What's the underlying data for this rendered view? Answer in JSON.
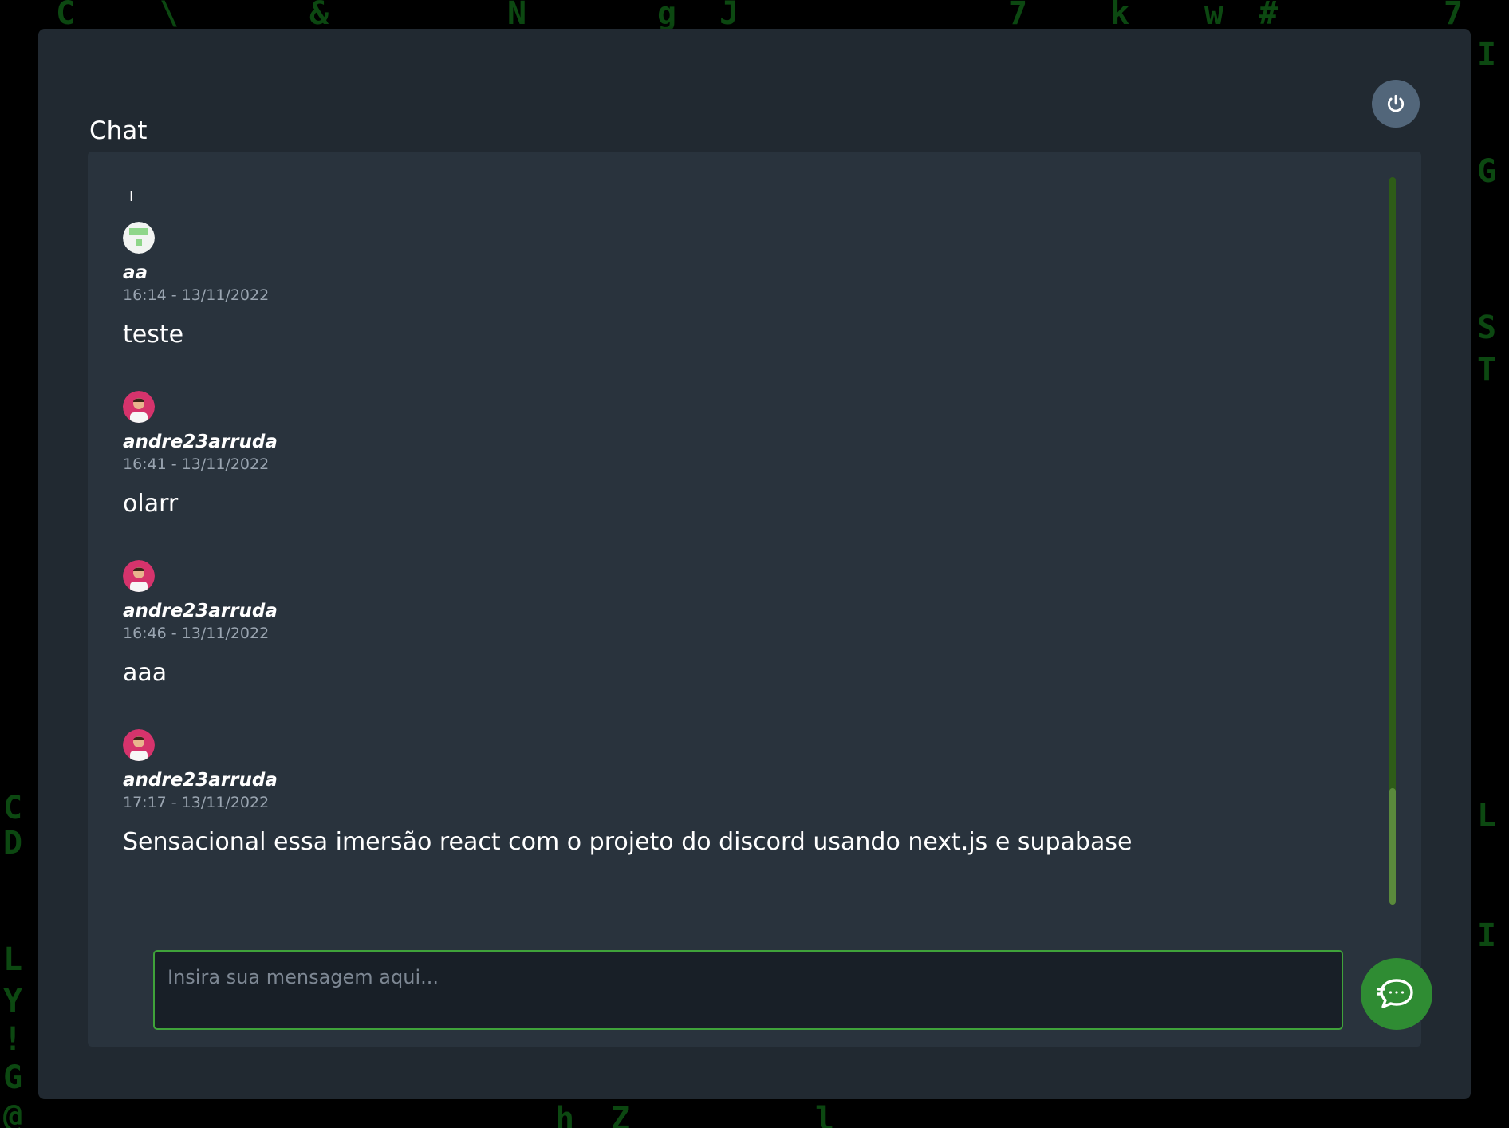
{
  "header": {
    "title": "Chat",
    "logout_icon": "power-icon"
  },
  "messages": [
    {
      "username": "aa",
      "timestamp": "16:14 - 13/11/2022",
      "text": "teste",
      "avatar": "generic-avatar"
    },
    {
      "username": "andre23arruda",
      "timestamp": "16:41 - 13/11/2022",
      "text": "olarr",
      "avatar": "user-photo-avatar"
    },
    {
      "username": "andre23arruda",
      "timestamp": "16:46 - 13/11/2022",
      "text": "aaa",
      "avatar": "user-photo-avatar"
    },
    {
      "username": "andre23arruda",
      "timestamp": "17:17 - 13/11/2022",
      "text": "Sensacional essa imersão react com o projeto do discord usando next.js e supabase",
      "avatar": "user-photo-avatar"
    }
  ],
  "partial_text": "I",
  "composer": {
    "placeholder": "Insira sua mensagem aqui...",
    "value": "",
    "send_icon": "chat-bubble-icon"
  },
  "colors": {
    "page_background": "#000000",
    "panel": "#212931",
    "chat_area": "#29333d",
    "accent_green": "#2f8c33",
    "input_border": "#3fa23a",
    "logout_button": "#52667a"
  },
  "background_glyphs": [
    "C",
    "\\",
    "&",
    "N",
    "g",
    "J",
    "7",
    "k",
    "w",
    "#",
    "7",
    "I",
    "G",
    "S",
    "T",
    "C",
    "D",
    "L",
    "Y",
    "!",
    "G",
    "@",
    "h",
    "Z",
    "l",
    "L",
    "I"
  ]
}
